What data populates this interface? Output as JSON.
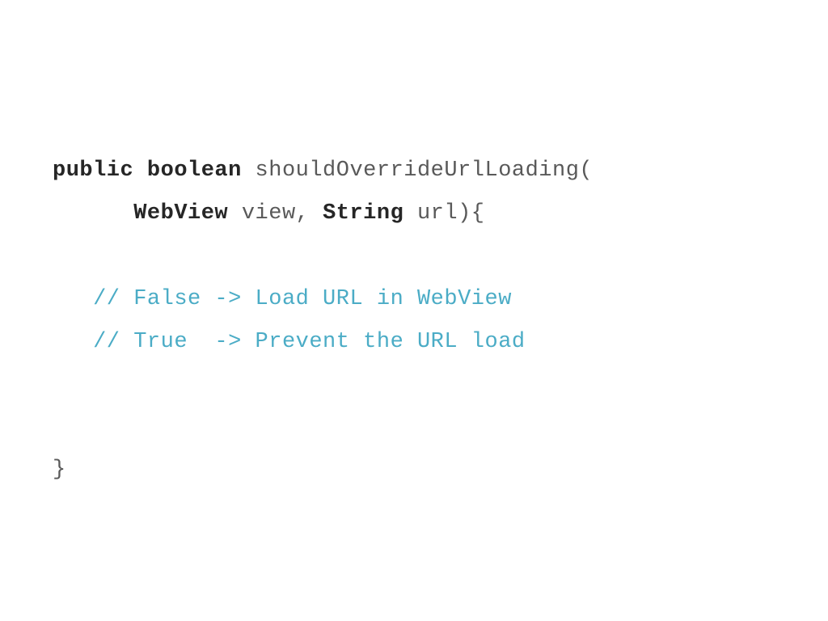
{
  "code": {
    "line1": {
      "kw_public": "public",
      "kw_boolean": "boolean",
      "method_name": " shouldOverrideUrlLoading("
    },
    "line2": {
      "indent": "      ",
      "type_webview": "WebView",
      "param1": " view, ",
      "type_string": "String",
      "param2": " url){"
    },
    "line3": "",
    "line4": {
      "indent": "   ",
      "comment": "// False -> Load URL in WebView"
    },
    "line5": {
      "indent": "   ",
      "comment": "// True  -> Prevent the URL load"
    },
    "line6": "",
    "line7": "",
    "line8": {
      "brace": "}"
    }
  }
}
